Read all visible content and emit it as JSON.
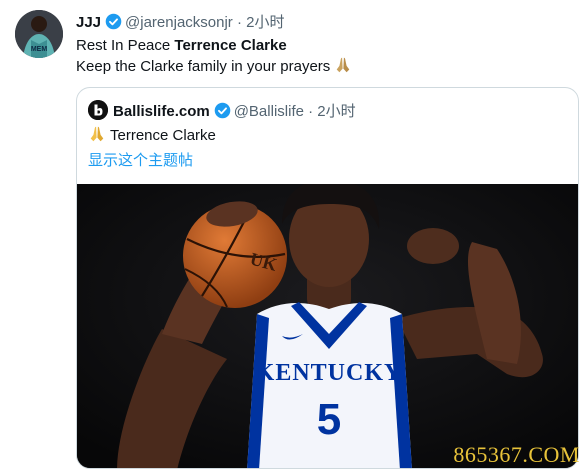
{
  "tweet": {
    "author_name": "JJJ",
    "handle": "@jarenjacksonjr",
    "separator": "·",
    "time": "2小时",
    "line1_prefix": "Rest In Peace ",
    "line1_bold": "Terrence Clarke",
    "line2": "Keep the Clarke family in your prayers",
    "avatar_jersey_letters": "MEM"
  },
  "quoted_tweet": {
    "author_name": "Ballislife.com",
    "handle": "@Ballislife",
    "separator": "·",
    "time": "2小时",
    "text": "Terrence Clarke",
    "show_thread_link": "显示这个主题帖",
    "photo": {
      "jersey_text": "KENTUCKY",
      "jersey_number": "5",
      "ball_logo": "UK"
    }
  },
  "watermark": "865367.COM",
  "colors": {
    "verified": "#1d9bf0",
    "link": "#1d9bf0",
    "muted": "#536471",
    "kentucky_blue": "#0033a0",
    "watermark": "#e8c33a"
  },
  "icons": [
    "verified-badge-icon",
    "folded-hands-emoji-icon",
    "ballislife-logo-icon"
  ]
}
